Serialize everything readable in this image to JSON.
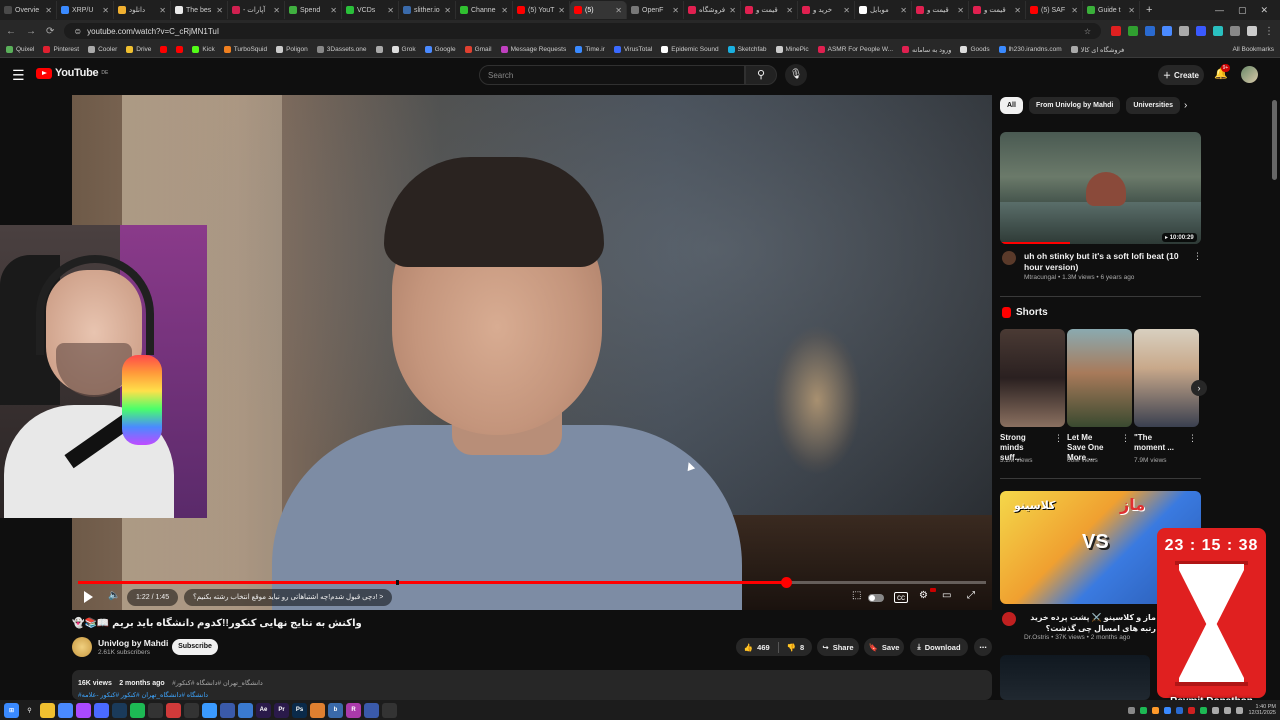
{
  "browser": {
    "tabs": [
      {
        "label": "Overvie",
        "color": "#4a4a4a",
        "active": false
      },
      {
        "label": "XRP/U",
        "color": "#3a8aff",
        "active": false
      },
      {
        "label": "دانلود",
        "color": "#f0b030",
        "active": false
      },
      {
        "label": "The bes",
        "color": "#eaeaea",
        "active": false
      },
      {
        "label": "- آپارات",
        "color": "#d02050",
        "active": false
      },
      {
        "label": "Spend",
        "color": "#40b040",
        "active": false
      },
      {
        "label": "VCDs",
        "color": "#2ac03a",
        "active": false
      },
      {
        "label": "slither.io",
        "color": "#3a6aaa",
        "active": false
      },
      {
        "label": "Channe",
        "color": "#30c030",
        "active": false
      },
      {
        "label": "(5) YouT",
        "color": "#ff0000",
        "active": false
      },
      {
        "label": "(5)",
        "color": "#ff0000",
        "active": true
      },
      {
        "label": "OpenF",
        "color": "#777777",
        "active": false
      },
      {
        "label": "فروشگاه",
        "color": "#e02050",
        "active": false
      },
      {
        "label": "قیمت و",
        "color": "#e02050",
        "active": false
      },
      {
        "label": "خرید و",
        "color": "#e02050",
        "active": false
      },
      {
        "label": "موبایل",
        "color": "#ffffff",
        "active": false
      },
      {
        "label": "قیمت و",
        "color": "#e02050",
        "active": false
      },
      {
        "label": "قیمت و",
        "color": "#e02050",
        "active": false
      },
      {
        "label": "(5) SAF",
        "color": "#ff0000",
        "active": false
      },
      {
        "label": "Guide t",
        "color": "#3ab03a",
        "active": false
      }
    ],
    "url": "youtube.com/watch?v=C_cRjMN1TuI",
    "bookmarks": [
      {
        "label": "Quixel",
        "color": "#5ab05a"
      },
      {
        "label": "Pinterest",
        "color": "#e02030"
      },
      {
        "label": "Cooler",
        "color": "#aaaaaa"
      },
      {
        "label": "Drive",
        "color": "#f0c030"
      },
      {
        "label": "",
        "color": "#ff0000"
      },
      {
        "label": "",
        "color": "#ff0000"
      },
      {
        "label": "Kick",
        "color": "#53fc18"
      },
      {
        "label": "TurboSquid",
        "color": "#f08020"
      },
      {
        "label": "Poligon",
        "color": "#cccccc"
      },
      {
        "label": "3Dassets.one",
        "color": "#888888"
      },
      {
        "label": "",
        "color": "#aaaaaa"
      },
      {
        "label": "Grok",
        "color": "#dddddd"
      },
      {
        "label": "Google",
        "color": "#4a8aff"
      },
      {
        "label": "Gmail",
        "color": "#e04030"
      },
      {
        "label": "Message Requests",
        "color": "#c040c0"
      },
      {
        "label": "Time.ir",
        "color": "#3a8aff"
      },
      {
        "label": "VirusTotal",
        "color": "#3a6aff"
      },
      {
        "label": "Epidemic Sound",
        "color": "#ffffff"
      },
      {
        "label": "Sketchfab",
        "color": "#1ab0e0"
      },
      {
        "label": "MinePic",
        "color": "#cccccc"
      },
      {
        "label": "ASMR For People W...",
        "color": "#e02050"
      },
      {
        "label": "ورود به سامانه",
        "color": "#e02050"
      },
      {
        "label": "Goods",
        "color": "#dddddd"
      },
      {
        "label": "lh230.irandns.com",
        "color": "#3a8aff"
      },
      {
        "label": "فروشگاه ای کالا",
        "color": "#aaaaaa"
      }
    ],
    "all_bookmarks": "All Bookmarks"
  },
  "youtube": {
    "logo": "YouTube",
    "region": "DE",
    "search_placeholder": "Search",
    "create_label": "Create",
    "notif_count": "9+"
  },
  "player": {
    "current_time": "1:22",
    "duration": "1:45",
    "progress": 0.78,
    "chapter": "< !دچی قبول شدم!چه اشتباهاتی رو نباید موقع انتخاب رشته بکنیم؟"
  },
  "video": {
    "title": "واکنش به نتایج نهایی کنکور!!کدوم دانشگاه باید بریم 📖📚👻",
    "channel": "Univlog by Mahdi",
    "subscribers": "2.61K subscribers",
    "subscribe_label": "Subscribe",
    "likes": "469",
    "dislikes": "8",
    "share_label": "Share",
    "save_label": "Save",
    "download_label": "Download",
    "views": "16K views",
    "uploaded": "2 months ago",
    "tags": "#دانشگاه_تهران #دانشگاه #کنکور",
    "tags_line2": "#دانشگاه #دانشگاه_تهران #کنکور #کنکور -علامه"
  },
  "sidebar": {
    "chips": [
      "All",
      "From Univlog by Mahdi",
      "Universities"
    ],
    "lofi": {
      "title": "uh oh stinky but it's a soft lofi beat (10 hour version)",
      "channel": "Mtracungal",
      "meta": "1.3M views • 6 years ago",
      "duration": "10:00:29"
    },
    "shorts_label": "Shorts",
    "shorts": [
      {
        "title": "Strong minds suff...",
        "views": "3.2M views"
      },
      {
        "title": "Let Me Save One More ...",
        "views": "66M views"
      },
      {
        "title": "\"The moment ...",
        "views": "7.9M views"
      }
    ],
    "maz": {
      "title": "ماز و کلاسینو ⚔️ پشت پرده خرید رتبه های امسال چی گذشت؟",
      "channel": "Dr.Ostris",
      "meta": "37K views • 2 months ago",
      "thumb_title": "ماز",
      "thumb_title2": "کلاسینو",
      "vs": "VS"
    }
  },
  "overlay": {
    "timer": "23 : 15 : 38",
    "donation": "Reymit Donathon"
  },
  "taskbar": {
    "icons": [
      {
        "name": "windows-icon",
        "color": "#3a8aff",
        "glyph": "⊞"
      },
      {
        "name": "search-icon",
        "color": "#1c1c1c",
        "glyph": "⚲"
      },
      {
        "name": "file-explorer-icon",
        "color": "#f0c030",
        "glyph": ""
      },
      {
        "name": "chrome-icon",
        "color": "#4a8aff",
        "glyph": ""
      },
      {
        "name": "app-icon",
        "color": "#aa4aff",
        "glyph": ""
      },
      {
        "name": "app-icon",
        "color": "#4a6aff",
        "glyph": ""
      },
      {
        "name": "steam-icon",
        "color": "#1a3a5a",
        "glyph": ""
      },
      {
        "name": "spotify-icon",
        "color": "#1db954",
        "glyph": ""
      },
      {
        "name": "app-icon",
        "color": "#333333",
        "glyph": ""
      },
      {
        "name": "app-icon",
        "color": "#d03a3a",
        "glyph": ""
      },
      {
        "name": "github-icon",
        "color": "#333333",
        "glyph": ""
      },
      {
        "name": "app-icon",
        "color": "#3a9aff",
        "glyph": ""
      },
      {
        "name": "app-icon",
        "color": "#3a5aaa",
        "glyph": ""
      },
      {
        "name": "app-icon",
        "color": "#3a7ad0",
        "glyph": ""
      },
      {
        "name": "ae-icon",
        "color": "#2a1a4a",
        "glyph": "Ae"
      },
      {
        "name": "pr-icon",
        "color": "#2a1a4a",
        "glyph": "Pr"
      },
      {
        "name": "ps-icon",
        "color": "#0a2a4a",
        "glyph": "Ps"
      },
      {
        "name": "blender-icon",
        "color": "#e08030",
        "glyph": ""
      },
      {
        "name": "b-icon",
        "color": "#3a6aaa",
        "glyph": "b"
      },
      {
        "name": "r-icon",
        "color": "#aa3aaa",
        "glyph": "R"
      },
      {
        "name": "app-icon",
        "color": "#3a5aaa",
        "glyph": ""
      },
      {
        "name": "app-icon",
        "color": "#333333",
        "glyph": ""
      }
    ],
    "clock": [
      "1:40 PM",
      "12/31/2025"
    ]
  }
}
